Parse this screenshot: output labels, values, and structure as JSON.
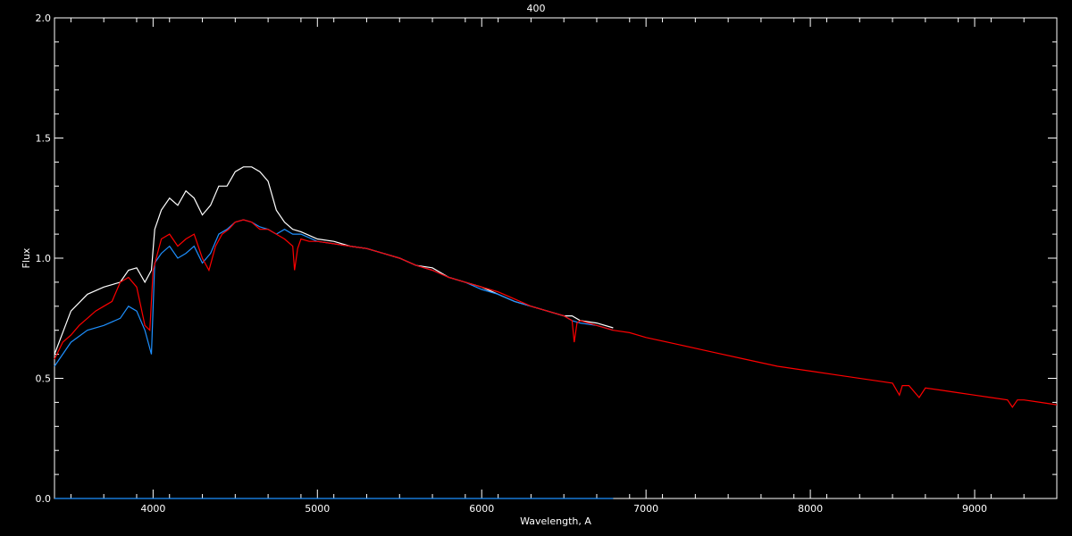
{
  "chart_data": {
    "type": "line",
    "title": "400",
    "xlabel": "Wavelength, A",
    "ylabel": "Flux",
    "xlim": [
      3400,
      9500
    ],
    "ylim": [
      0.0,
      2.0
    ],
    "x_ticks": [
      4000,
      5000,
      6000,
      7000,
      8000,
      9000
    ],
    "y_ticks": [
      "0.0",
      "0.5",
      "1.0",
      "1.5",
      "2.0"
    ],
    "grid": false,
    "legend": "none",
    "background": "#000000",
    "axis_color": "#ffffff",
    "series": [
      {
        "color": "#ffffff",
        "x": [
          3400,
          3500,
          3600,
          3700,
          3800,
          3850,
          3900,
          3950,
          3990,
          4010,
          4050,
          4100,
          4150,
          4200,
          4250,
          4300,
          4350,
          4400,
          4450,
          4500,
          4550,
          4600,
          4650,
          4700,
          4750,
          4800,
          4850,
          4900,
          5000,
          5100,
          5200,
          5300,
          5400,
          5500,
          5600,
          5700,
          5800,
          5900,
          6000,
          6100,
          6200,
          6300,
          6400,
          6500,
          6550,
          6600,
          6700,
          6800
        ],
        "y": [
          0.6,
          0.78,
          0.85,
          0.88,
          0.9,
          0.95,
          0.96,
          0.9,
          0.95,
          1.12,
          1.2,
          1.25,
          1.22,
          1.28,
          1.25,
          1.18,
          1.22,
          1.3,
          1.3,
          1.36,
          1.38,
          1.38,
          1.36,
          1.32,
          1.2,
          1.15,
          1.12,
          1.11,
          1.08,
          1.07,
          1.05,
          1.04,
          1.02,
          1.0,
          0.97,
          0.96,
          0.92,
          0.9,
          0.88,
          0.85,
          0.82,
          0.8,
          0.78,
          0.76,
          0.76,
          0.74,
          0.73,
          0.71
        ]
      },
      {
        "color": "#1e90ff",
        "x": [
          3400,
          3500,
          3600,
          3700,
          3800,
          3850,
          3900,
          3950,
          3990,
          4010,
          4050,
          4100,
          4150,
          4200,
          4250,
          4300,
          4350,
          4400,
          4450,
          4500,
          4550,
          4600,
          4650,
          4700,
          4750,
          4800,
          4850,
          4900,
          5000,
          5100,
          5200,
          5300,
          5400,
          5500,
          5600,
          5700,
          5800,
          5900,
          6000,
          6100,
          6200,
          6300,
          6400,
          6500,
          6550,
          6600,
          6700,
          6800
        ],
        "y": [
          0.55,
          0.65,
          0.7,
          0.72,
          0.75,
          0.8,
          0.78,
          0.7,
          0.6,
          0.98,
          1.02,
          1.05,
          1.0,
          1.02,
          1.05,
          0.98,
          1.02,
          1.1,
          1.12,
          1.15,
          1.16,
          1.15,
          1.13,
          1.12,
          1.1,
          1.12,
          1.1,
          1.1,
          1.07,
          1.06,
          1.05,
          1.04,
          1.02,
          1.0,
          0.97,
          0.95,
          0.92,
          0.9,
          0.87,
          0.85,
          0.82,
          0.8,
          0.78,
          0.76,
          0.74,
          0.73,
          0.72,
          0.7
        ]
      },
      {
        "color": "#ff0000",
        "x": [
          3400,
          3450,
          3500,
          3550,
          3600,
          3650,
          3700,
          3750,
          3800,
          3850,
          3900,
          3950,
          3980,
          4000,
          4050,
          4100,
          4150,
          4200,
          4250,
          4300,
          4340,
          4380,
          4420,
          4460,
          4500,
          4550,
          4600,
          4650,
          4700,
          4750,
          4800,
          4850,
          4861,
          4880,
          4900,
          4950,
          5000,
          5100,
          5200,
          5300,
          5400,
          5500,
          5600,
          5700,
          5800,
          5900,
          6000,
          6100,
          6200,
          6300,
          6400,
          6500,
          6550,
          6563,
          6580,
          6600,
          6700,
          6800,
          6900,
          7000,
          7200,
          7400,
          7600,
          7800,
          8000,
          8200,
          8400,
          8500,
          8542,
          8560,
          8600,
          8662,
          8700,
          8800,
          8900,
          9000,
          9100,
          9200,
          9230,
          9260,
          9300,
          9400,
          9500
        ],
        "y": [
          0.58,
          0.65,
          0.68,
          0.72,
          0.75,
          0.78,
          0.8,
          0.82,
          0.9,
          0.92,
          0.88,
          0.72,
          0.7,
          0.95,
          1.08,
          1.1,
          1.05,
          1.08,
          1.1,
          1.0,
          0.95,
          1.05,
          1.1,
          1.12,
          1.15,
          1.16,
          1.15,
          1.12,
          1.12,
          1.1,
          1.08,
          1.05,
          0.95,
          1.04,
          1.08,
          1.07,
          1.07,
          1.06,
          1.05,
          1.04,
          1.02,
          1.0,
          0.97,
          0.95,
          0.92,
          0.9,
          0.88,
          0.86,
          0.83,
          0.8,
          0.78,
          0.76,
          0.74,
          0.65,
          0.73,
          0.74,
          0.72,
          0.7,
          0.69,
          0.67,
          0.64,
          0.61,
          0.58,
          0.55,
          0.53,
          0.51,
          0.49,
          0.48,
          0.43,
          0.47,
          0.47,
          0.42,
          0.46,
          0.45,
          0.44,
          0.43,
          0.42,
          0.41,
          0.38,
          0.41,
          0.41,
          0.4,
          0.39
        ]
      },
      {
        "color": "#1e90ff",
        "x": [
          3400,
          6800
        ],
        "y": [
          0.0,
          0.0
        ]
      }
    ]
  }
}
